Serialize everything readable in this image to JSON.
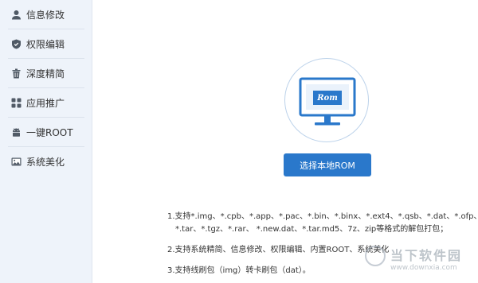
{
  "sidebar": {
    "items": [
      {
        "label": "信息修改",
        "icon": "user-icon"
      },
      {
        "label": "权限编辑",
        "icon": "shield-icon"
      },
      {
        "label": "深度精简",
        "icon": "trash-icon"
      },
      {
        "label": "应用推广",
        "icon": "apps-icon"
      },
      {
        "label": "一键ROOT",
        "icon": "android-icon"
      },
      {
        "label": "系统美化",
        "icon": "image-icon"
      }
    ]
  },
  "main": {
    "rom_icon": {
      "label": "Rom",
      "icon": "monitor-icon"
    },
    "select_button": "选择本地ROM",
    "info": {
      "line1": "1.支持*.img、*.cpb、*.app、*.pac、*.bin、*.binx、*.ext4、*.qsb、*.dat、*.ofp、",
      "line1b": "*.tar、*.tgz、*.rar、 *.new.dat、*.tar.md5、7z、zip等格式的解包打包；",
      "line2": "2.支持系统精简、信息修改、权限编辑、内置ROOT、系统美化",
      "line3": "3.支持线刷包（img）转卡刷包（dat）。"
    }
  },
  "watermark": {
    "cn": "当下软件园",
    "en": "www.downxia.com"
  },
  "colors": {
    "accent": "#2a78cb",
    "sidebar_bg": "#eef3fa",
    "icon_gray": "#505a66"
  }
}
